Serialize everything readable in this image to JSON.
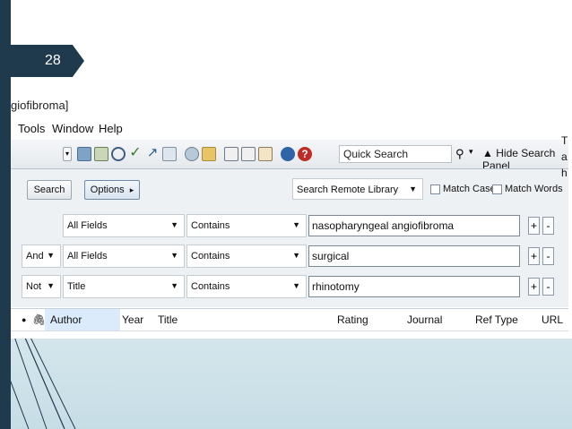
{
  "slide": {
    "page_number": "28",
    "colors": {
      "sidebar": "#1f3a4d",
      "band": "#cfe3ea"
    }
  },
  "window": {
    "title_fragment": "giofibroma]"
  },
  "menu": {
    "items": [
      "Tools",
      "Window",
      "Help"
    ]
  },
  "toolbar": {
    "quick_search_placeholder": "Quick Search",
    "hide_panel_label": "Hide Search Panel",
    "icons": [
      "dropdown-arrow-icon",
      "copy-icon",
      "export-icon",
      "find-icon",
      "insert-citation-icon",
      "go-icon",
      "groups-icon",
      "sync-icon",
      "folder-icon",
      "preview-icon",
      "format-icon",
      "edit-icon",
      "online-search-icon",
      "help-icon"
    ]
  },
  "search_panel": {
    "search_button": "Search",
    "options_button": "Options",
    "options_arrow": "▸",
    "library_select": "Search Remote Library",
    "match_case": "Match Case",
    "match_words": "Match Words",
    "rows": [
      {
        "bool": "",
        "field": "All Fields",
        "operator": "Contains",
        "value": "nasopharyngeal angiofibroma"
      },
      {
        "bool": "And",
        "field": "All Fields",
        "operator": "Contains",
        "value": "surgical"
      },
      {
        "bool": "Not",
        "field": "Title",
        "operator": "Contains",
        "value": "rhinotomy"
      }
    ],
    "plus": "+",
    "minus": "-"
  },
  "results": {
    "columns": [
      "Author",
      "Year",
      "Title",
      "Rating",
      "Journal",
      "Ref Type",
      "URL"
    ]
  },
  "edge_text": [
    "T",
    "a",
    "h"
  ]
}
